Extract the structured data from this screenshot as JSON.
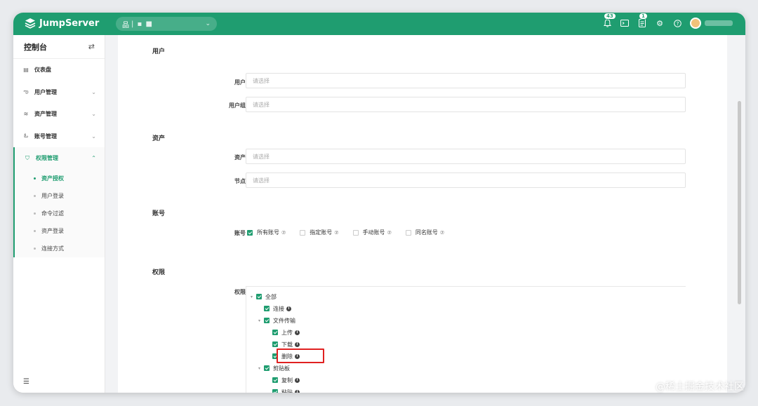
{
  "brand": {
    "name": "JumpServer",
    "primary": "#1f9d70",
    "highlight": "#e02020"
  },
  "topbar": {
    "org_icon": "品",
    "org_name": "|  ▪ ■",
    "notify_count": "43",
    "ticket_count": "1",
    "icons": [
      "bell-icon",
      "terminal-icon",
      "ticket-icon",
      "settings-icon",
      "help-icon"
    ]
  },
  "sidebar": {
    "title": "控制台",
    "items": [
      {
        "label": "仪表盘",
        "icon": "dashboard-icon",
        "glyph": "▤",
        "has_children": false
      },
      {
        "label": "用户管理",
        "icon": "users-icon",
        "glyph": "ఌ",
        "has_children": true
      },
      {
        "label": "资产管理",
        "icon": "assets-icon",
        "glyph": "≋",
        "has_children": true
      },
      {
        "label": "账号管理",
        "icon": "accounts-icon",
        "glyph": "ఓ",
        "has_children": true
      }
    ],
    "active_group": {
      "label": "权限管理",
      "icon": "shield-icon",
      "glyph": "⛉",
      "children": [
        "资产授权",
        "用户登录",
        "命令过滤",
        "资产登录",
        "连接方式"
      ]
    }
  },
  "form": {
    "section_user": "用户",
    "user_label": "用户",
    "user_placeholder": "请选择",
    "usergroup_label": "用户组",
    "usergroup_placeholder": "请选择",
    "section_asset": "资产",
    "asset_label": "资产",
    "asset_placeholder": "请选择",
    "node_label": "节点",
    "node_placeholder": "请选择",
    "section_account": "账号",
    "account_label": "账号",
    "account_options": [
      {
        "label": "所有账号",
        "checked": true
      },
      {
        "label": "指定账号",
        "checked": false
      },
      {
        "label": "手动账号",
        "checked": false
      },
      {
        "label": "同名账号",
        "checked": false
      }
    ],
    "section_perm": "权限",
    "perm_label": "权限",
    "tree": {
      "all": "全部",
      "connect": "连接",
      "file_transfer": "文件传输",
      "upload": "上传",
      "download": "下载",
      "delete": "删除",
      "clipboard": "剪贴板",
      "copy": "复制",
      "paste": "粘贴"
    }
  },
  "watermark": "@稀土掘金技术社区"
}
